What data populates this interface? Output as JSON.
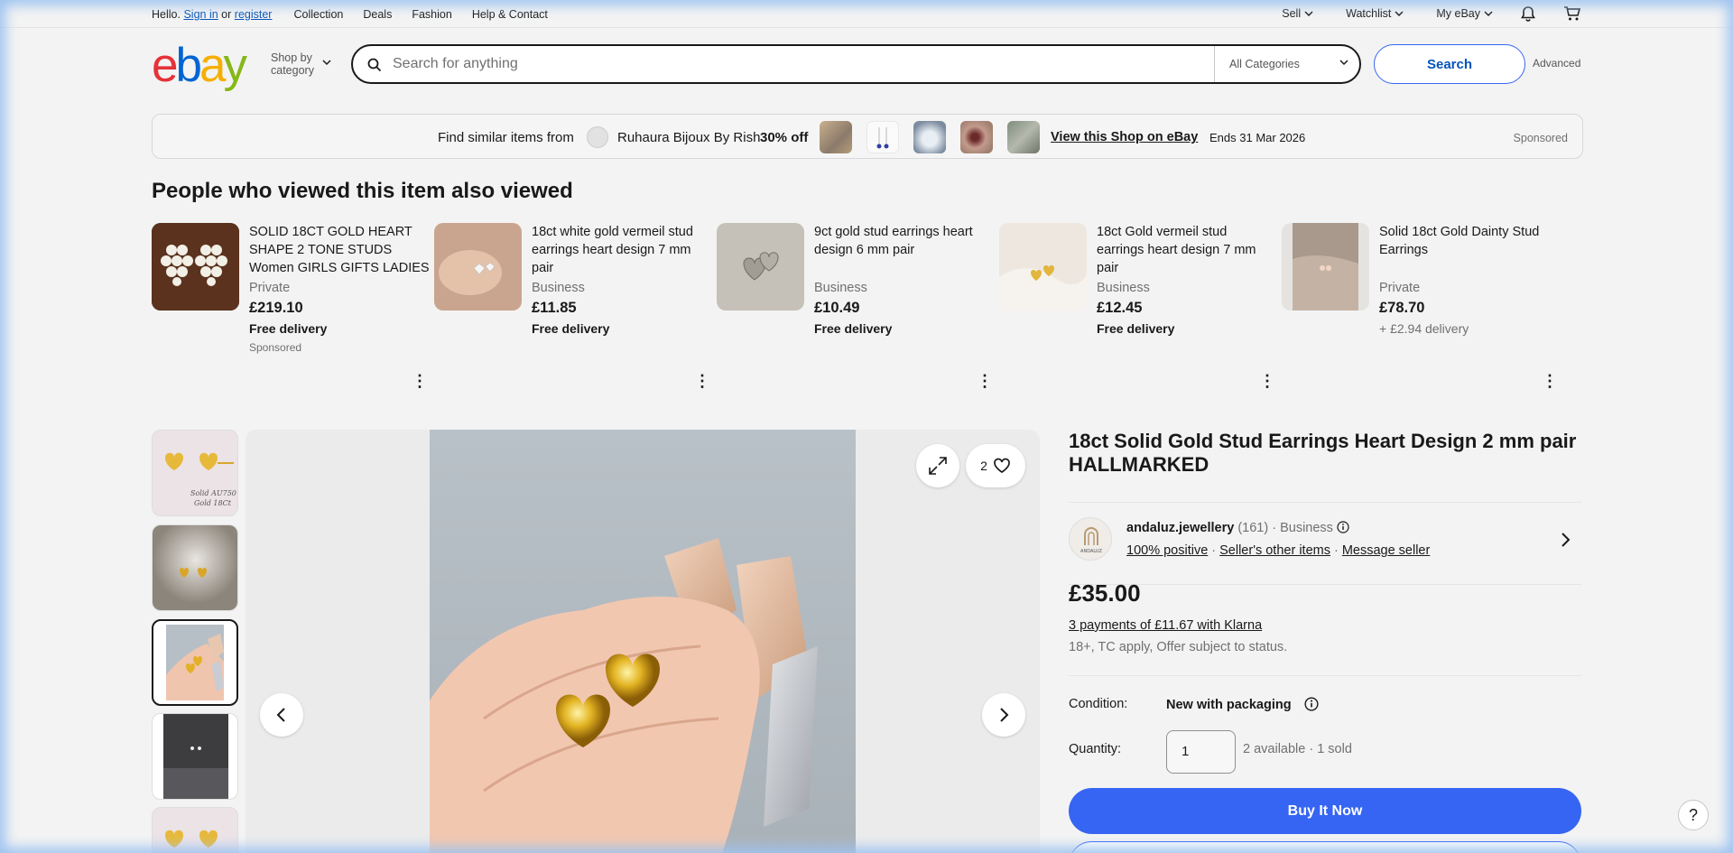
{
  "topnav": {
    "hello": "Hello.",
    "sign_in": "Sign in",
    "or": "or",
    "register": "register",
    "items": [
      "Collection",
      "Deals",
      "Fashion",
      "Help & Contact"
    ],
    "right": [
      "Sell",
      "Watchlist",
      "My eBay"
    ]
  },
  "header": {
    "logo": [
      "e",
      "b",
      "a",
      "y"
    ],
    "shop_by_line1": "Shop by",
    "shop_by_line2": "category",
    "search_placeholder": "Search for anything",
    "category": "All Categories",
    "search_button": "Search",
    "advanced": "Advanced"
  },
  "banner": {
    "find_text": "Find similar items from",
    "shop_name": "Ruhaura Bijoux By Rish",
    "discount": "30% off",
    "view_shop": "View this Shop on eBay",
    "ends": "Ends 31 Mar 2026",
    "sponsored": "Sponsored"
  },
  "also_viewed": {
    "title": "People who viewed this item also viewed",
    "items": [
      {
        "title": "SOLID 18CT GOLD HEART SHAPE 2 TONE STUDS Women GIRLS GIFTS LADIES",
        "seller": "Private",
        "price": "£219.10",
        "delivery": "Free delivery",
        "sponsored": "Sponsored"
      },
      {
        "title": "18ct white gold vermeil stud earrings heart design 7 mm pair",
        "seller": "Business",
        "price": "£11.85",
        "delivery": "Free delivery",
        "sponsored": ""
      },
      {
        "title": "9ct gold stud earrings heart design 6 mm pair",
        "seller": "Business",
        "price": "£10.49",
        "delivery": "Free delivery",
        "sponsored": ""
      },
      {
        "title": "18ct Gold vermeil stud earrings heart design 7 mm pair",
        "seller": "Business",
        "price": "£12.45",
        "delivery": "Free delivery",
        "sponsored": ""
      },
      {
        "title": "Solid 18ct Gold Dainty Stud Earrings",
        "seller": "Private",
        "price": "£78.70",
        "delivery": "+ £2.94 delivery",
        "sponsored": ""
      }
    ]
  },
  "gallery": {
    "like_count": "2",
    "thumb1_caption_a": "Solid AU750",
    "thumb1_caption_b": "Gold 18Ct"
  },
  "product": {
    "title": "18ct Solid Gold Stud Earrings Heart Design 2 mm pair HALLMARKED",
    "seller_name": "andaluz.jewellery",
    "seller_count": "(161)",
    "seller_type": "Business",
    "seller_logo_text": "ANDALUZ",
    "positive": "100% positive",
    "other_items": "Seller's other items",
    "message": "Message seller",
    "price": "£35.00",
    "klarna": "3 payments of £11.67 with Klarna",
    "tc": "18+, TC apply, Offer subject to status.",
    "condition_label": "Condition:",
    "condition_value": "New with packaging",
    "quantity_label": "Quantity:",
    "quantity_value": "1",
    "availability": "2 available · 1 sold",
    "buy_now": "Buy It Now"
  },
  "help": "?"
}
